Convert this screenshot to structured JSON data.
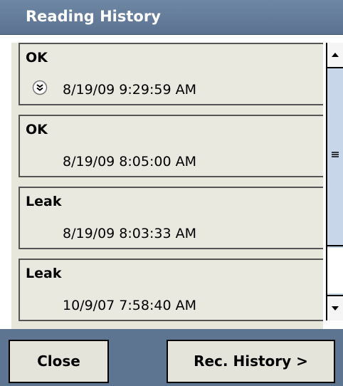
{
  "window": {
    "title": "Reading History"
  },
  "readings": [
    {
      "status": "OK",
      "timestamp": "8/19/09 9:29:59 AM",
      "has_icon": true
    },
    {
      "status": "OK",
      "timestamp": "8/19/09 8:05:00 AM",
      "has_icon": false
    },
    {
      "status": "Leak",
      "timestamp": "8/19/09 8:03:33 AM",
      "has_icon": false
    },
    {
      "status": "Leak",
      "timestamp": "10/9/07 7:58:40 AM",
      "has_icon": false
    }
  ],
  "buttons": {
    "close_label": "Close",
    "rec_history_label": "Rec. History >"
  },
  "icons": {
    "expand": "expand-chevron-icon",
    "scroll_up": "scroll-up-arrow-icon",
    "scroll_down": "scroll-down-arrow-icon",
    "grip": "scroll-grip-icon"
  },
  "colors": {
    "titlebar": "#5b7391",
    "frame": "#5e7591",
    "item_background": "#e9e9df",
    "scrollbar_track": "#c7d6e8"
  }
}
